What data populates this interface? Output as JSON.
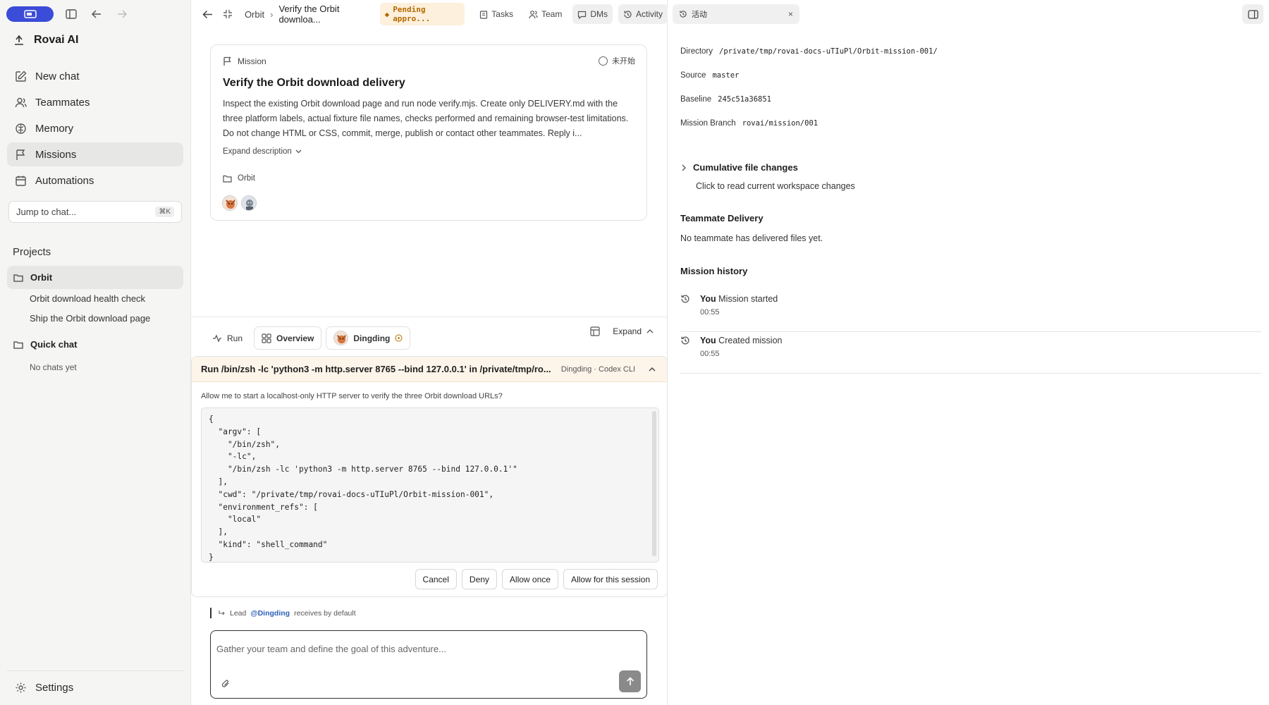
{
  "sidebar": {
    "brand": "Rovai AI",
    "nav": [
      {
        "label": "New chat"
      },
      {
        "label": "Teammates"
      },
      {
        "label": "Memory"
      },
      {
        "label": "Missions"
      },
      {
        "label": "Automations"
      }
    ],
    "jump_placeholder": "Jump to chat...",
    "jump_shortcut": "⌘K",
    "projects_label": "Projects",
    "projects": [
      {
        "name": "Orbit",
        "items": [
          "Orbit download health check",
          "Ship the Orbit download page"
        ]
      },
      {
        "name": "Quick chat",
        "empty": "No chats yet"
      }
    ],
    "settings_label": "Settings"
  },
  "topbar": {
    "crumb_project": "Orbit",
    "crumb_sep": "›",
    "crumb_title": "Verify the Orbit downloa...",
    "status_badge": "Pending appro...",
    "tabs": [
      "Tasks",
      "Team",
      "DMs",
      "Activity"
    ]
  },
  "mission": {
    "label": "Mission",
    "status": "未开始",
    "title": "Verify the Orbit download delivery",
    "description": "Inspect the existing Orbit download page and run node verify.mjs. Create only DELIVERY.md with the three platform labels, actual fixture file names, checks performed and remaining browser-test limitations. Do not change HTML or CSS, commit, merge, publish or contact other teammates. Reply i...",
    "expand_label": "Expand description",
    "folder": "Orbit"
  },
  "bottom_tabs": {
    "run": "Run",
    "overview": "Overview",
    "agent": "Dingding",
    "expand": "Expand"
  },
  "approval": {
    "command": "Run /bin/zsh -lc 'python3 -m http.server 8765 --bind 127.0.0.1' in /private/tmp/ro...",
    "requester": "Dingding · Codex CLI",
    "question": "Allow me to start a localhost-only HTTP server to verify the three Orbit download URLs?",
    "code": "{\n  \"argv\": [\n    \"/bin/zsh\",\n    \"-lc\",\n    \"/bin/zsh -lc 'python3 -m http.server 8765 --bind 127.0.0.1'\"\n  ],\n  \"cwd\": \"/private/tmp/rovai-docs-uTIuPl/Orbit-mission-001\",\n  \"environment_refs\": [\n    \"local\"\n  ],\n  \"kind\": \"shell_command\"\n}",
    "buttons": [
      "Cancel",
      "Deny",
      "Allow once",
      "Allow for this session"
    ]
  },
  "composer": {
    "lead_prefix": "Lead",
    "lead_mention": "@Dingding",
    "lead_suffix": "receives by default",
    "placeholder": "Gather your team and define the goal of this adventure..."
  },
  "right": {
    "tab_label": "活动",
    "fields": [
      {
        "key": "Directory",
        "value": "/private/tmp/rovai-docs-uTIuPl/Orbit-mission-001/"
      },
      {
        "key": "Source",
        "value": "master"
      },
      {
        "key": "Baseline",
        "value": "245c51a36851"
      },
      {
        "key": "Mission Branch",
        "value": "rovai/mission/001"
      }
    ],
    "cumulative_title": "Cumulative file changes",
    "cumulative_hint": "Click to read current workspace changes",
    "delivery_title": "Teammate Delivery",
    "delivery_text": "No teammate has delivered files yet.",
    "history_title": "Mission history",
    "history": [
      {
        "who": "You",
        "action": "Mission started",
        "time": "00:55"
      },
      {
        "who": "You",
        "action": "Created mission",
        "time": "00:55"
      }
    ]
  },
  "colors": {
    "accent": "#3b4cd8",
    "pending_bg": "#fdf0dc",
    "pending_fg": "#b36b00",
    "mention": "#2b5fb8"
  }
}
